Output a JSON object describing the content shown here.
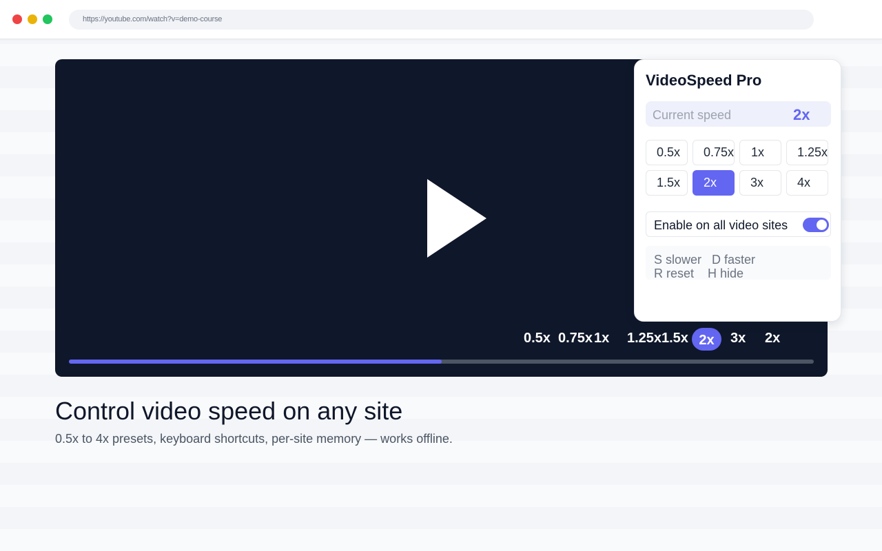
{
  "browser": {
    "url": "https://youtube.com/watch?v=demo-course"
  },
  "player": {
    "speed_chips": [
      "0.5x",
      "0.75x",
      "1x",
      "1.25x",
      "1.5x",
      "2x",
      "3x",
      "2x"
    ],
    "progress_percent": 50
  },
  "panel": {
    "title": "VideoSpeed Pro",
    "current_speed_label": "Current speed",
    "current_speed_value": "2x",
    "presets": [
      "0.5x",
      "0.75x",
      "1x",
      "1.25x",
      "1.5x",
      "2x",
      "3x",
      "4x"
    ],
    "selected_preset": "2x",
    "toggle_label": "Enable on all video sites",
    "toggle_on": true,
    "shortcuts": {
      "slower": "S slower",
      "faster": "D faster",
      "reset": "R reset",
      "hide": "H hide"
    }
  },
  "page": {
    "headline": "Control video speed on any site",
    "subline": "0.5x to 4x presets, keyboard shortcuts, per-site memory — works offline."
  },
  "colors": {
    "accent": "#6366f1",
    "player_bg": "#0f172a"
  },
  "icons": {
    "play": "play-icon"
  }
}
